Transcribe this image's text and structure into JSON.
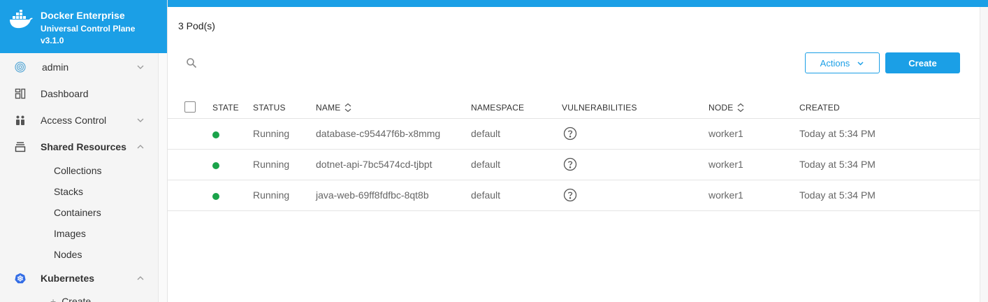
{
  "brand": {
    "title": "Docker Enterprise",
    "subtitle": "Universal Control Plane",
    "version": "v3.1.0",
    "color": "#1b9fe6"
  },
  "sidebar": {
    "user": "admin",
    "items": [
      {
        "label": "Dashboard",
        "icon": "dashboard-icon"
      },
      {
        "label": "Access Control",
        "icon": "access-control-icon"
      },
      {
        "label": "Shared Resources",
        "icon": "shared-resources-icon"
      },
      {
        "label": "Kubernetes",
        "icon": "kubernetes-icon"
      }
    ],
    "shared_resources_sub": [
      "Collections",
      "Stacks",
      "Containers",
      "Images",
      "Nodes"
    ],
    "kubernetes_sub": [
      "Create"
    ]
  },
  "main": {
    "pod_count": "3 Pod(s)",
    "actions_label": "Actions",
    "create_label": "Create"
  },
  "table": {
    "headers": {
      "state": "STATE",
      "status": "STATUS",
      "name": "NAME",
      "namespace": "NAMESPACE",
      "vulnerabilities": "VULNERABILITIES",
      "node": "NODE",
      "created": "CREATED"
    },
    "rows": [
      {
        "status": "Running",
        "name": "database-c95447f6b-x8mmg",
        "namespace": "default",
        "node": "worker1",
        "created": "Today at 5:34 PM",
        "state_color": "#1aa34a"
      },
      {
        "status": "Running",
        "name": "dotnet-api-7bc5474cd-tjbpt",
        "namespace": "default",
        "node": "worker1",
        "created": "Today at 5:34 PM",
        "state_color": "#1aa34a"
      },
      {
        "status": "Running",
        "name": "java-web-69ff8fdfbc-8qt8b",
        "namespace": "default",
        "node": "worker1",
        "created": "Today at 5:34 PM",
        "state_color": "#1aa34a"
      }
    ]
  }
}
